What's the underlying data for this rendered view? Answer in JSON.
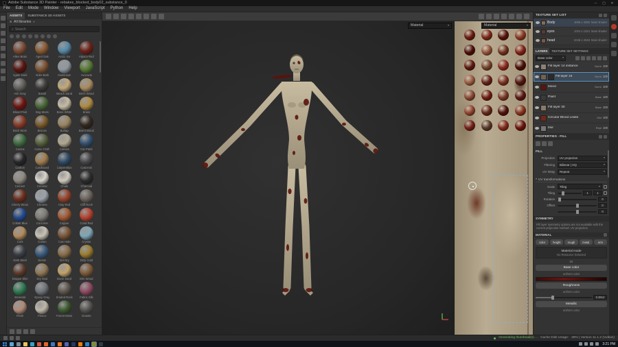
{
  "window": {
    "title": "Adobe Substance 3D Painter - rebakes_blocked_body02_substance_0",
    "menus": [
      "File",
      "Edit",
      "Mode",
      "Window",
      "Viewport",
      "JavaScript",
      "Python",
      "Help"
    ]
  },
  "tools": {
    "left_strip": [
      "paint-tool-icon",
      "eraser-tool-icon",
      "projection-tool-icon",
      "polygon-fill-tool-icon",
      "smudge-tool-icon",
      "clone-tool-icon",
      "material-picker-tool-icon",
      "quick-mask-tool-icon",
      "selection-tool-icon"
    ],
    "toolbar": [
      "transform-icon",
      "paint-brush-icon",
      "eraser-icon",
      "projection-icon",
      "fill-bucket-icon",
      "smudge-icon",
      "clone-stamp-icon",
      "geometry-mask-icon"
    ],
    "viewport_controls": [
      "pause-icon",
      "camera-icon",
      "snapshot-icon",
      "rotate-view-icon",
      "light-rotation-icon",
      "shadow-toggle-icon",
      "fullscreen-icon"
    ]
  },
  "assets": {
    "tabs": [
      "ASSETS",
      "SUBSTANCE 3D ASSETS"
    ],
    "filter_label": "All libraries",
    "search_placeholder": "Search",
    "filter_icons": [
      "filter-all-icon",
      "filter-materials-icon",
      "filter-smart-materials-icon",
      "filter-smart-masks-icon",
      "filter-brushes-icon",
      "filter-alphas-icon",
      "filter-textures-icon",
      "filter-filters-icon"
    ],
    "bottom_icons": [
      "grid-view-icon",
      "list-view-icon",
      "import-resources-icon",
      "shelf-settings-icon"
    ],
    "materials": [
      {
        "n": "Alien Brain",
        "c": "#7a4a34"
      },
      {
        "n": "Aged Oak",
        "c": "#8a5a33"
      },
      {
        "n": "Arctic Ice",
        "c": "#5588a6"
      },
      {
        "n": "Alpaca Red",
        "c": "#6e2018"
      },
      {
        "n": "Agate Dark",
        "c": "#5a1510"
      },
      {
        "n": "Alder Bark",
        "c": "#7c5232"
      },
      {
        "n": "Aluminium",
        "c": "#8e979e"
      },
      {
        "n": "Avocado",
        "c": "#567a32"
      },
      {
        "n": "Ash Gray",
        "c": "#62605c"
      },
      {
        "n": "Basalt",
        "c": "#3e3c3a"
      },
      {
        "n": "Beach Sand",
        "c": "#c2a878"
      },
      {
        "n": "Birch Wood",
        "c": "#a88a5e"
      },
      {
        "n": "Blood Pool",
        "c": "#701510"
      },
      {
        "n": "Bog Moss",
        "c": "#4a6638"
      },
      {
        "n": "Bone White",
        "c": "#c5bba2"
      },
      {
        "n": "Brass",
        "c": "#b08a42"
      },
      {
        "n": "Brick Worn",
        "c": "#8a3a28"
      },
      {
        "n": "Bronze",
        "c": "#7a5a2c"
      },
      {
        "n": "Burlap",
        "c": "#9a8460"
      },
      {
        "n": "Burnt Wood",
        "c": "#32281f"
      },
      {
        "n": "Cactus",
        "c": "#3f6b3f"
      },
      {
        "n": "Camo Cloth",
        "c": "#56603c"
      },
      {
        "n": "Canvas",
        "c": "#b0a88e"
      },
      {
        "n": "Car Paint",
        "c": "#32506e"
      },
      {
        "n": "Carbon",
        "c": "#26262a"
      },
      {
        "n": "Cardboard",
        "c": "#a07c4e"
      },
      {
        "n": "Carpet Blue",
        "c": "#2e4a66"
      },
      {
        "n": "Cast Iron",
        "c": "#46464a"
      },
      {
        "n": "Cement",
        "c": "#8e8a82"
      },
      {
        "n": "Ceramic",
        "c": "#d8d4cc"
      },
      {
        "n": "Chalk",
        "c": "#cfc9bd"
      },
      {
        "n": "Charcoal",
        "c": "#2c2c2c"
      },
      {
        "n": "Cherry Wood",
        "c": "#6e2f1e"
      },
      {
        "n": "Chrome",
        "c": "#9aa2aa"
      },
      {
        "n": "Clay Red",
        "c": "#96422a"
      },
      {
        "n": "Cliff Rock",
        "c": "#6a625a"
      },
      {
        "n": "Cobalt Blue",
        "c": "#244a8e"
      },
      {
        "n": "Concrete",
        "c": "#7e7c76"
      },
      {
        "n": "Copper",
        "c": "#a45a32"
      },
      {
        "n": "Coral Red",
        "c": "#b6422e"
      },
      {
        "n": "Cork",
        "c": "#b28a5c"
      },
      {
        "n": "Cotton",
        "c": "#c8c2b4"
      },
      {
        "n": "Cow Hide",
        "c": "#7a5636"
      },
      {
        "n": "Crystal",
        "c": "#7ea6b6"
      },
      {
        "n": "Dark Steel",
        "c": "#3a3e44"
      },
      {
        "n": "Denim",
        "c": "#3a5a7c"
      },
      {
        "n": "Dirt Dry",
        "c": "#8a6c48"
      },
      {
        "n": "Dirty Gold",
        "c": "#9a7c2e"
      },
      {
        "n": "Dragon Skin",
        "c": "#5c3a2a"
      },
      {
        "n": "Dry Mud",
        "c": "#907856"
      },
      {
        "n": "Dune Sand",
        "c": "#c2a269"
      },
      {
        "n": "Elm Wood",
        "c": "#7e5a38"
      },
      {
        "n": "Emerald",
        "c": "#2e7a52"
      },
      {
        "n": "Epoxy Gray",
        "c": "#70747a"
      },
      {
        "n": "Eroded Rock",
        "c": "#5e564c"
      },
      {
        "n": "Fabric Silk",
        "c": "#8e4a62"
      },
      {
        "n": "Flesh",
        "c": "#b08a76"
      },
      {
        "n": "Fleece",
        "c": "#bdb6a8"
      },
      {
        "n": "Forest Moss",
        "c": "#3c5a30"
      },
      {
        "n": "Granite",
        "c": "#55534f"
      }
    ]
  },
  "viewport": {
    "shading_mode": "Material"
  },
  "view2d": {
    "mode": "Material",
    "spheres": [
      "#6a1d12",
      "#7c2a1a",
      "#55150e",
      "#8a3b24",
      "#4a0f0a",
      "#93553c",
      "#6e3420",
      "#812218",
      "#5c1a10",
      "#74452e",
      "#8a2c1e",
      "#471008",
      "#9a5c42",
      "#63241a",
      "#7b3322",
      "#52160f",
      "#884a34",
      "#6d1f14",
      "#793a28",
      "#581812",
      "#90462f",
      "#65291c",
      "#4e130c",
      "#86351f",
      "#72221a",
      "#5a3a2a",
      "#832d1c",
      "#69150e"
    ]
  },
  "texture_sets": {
    "title": "TEXTURE SET LIST",
    "items": [
      {
        "name": "Body",
        "resolution": "4096 x 4096",
        "shader": "Main shader",
        "color": "#8a6a52",
        "selected": true
      },
      {
        "name": "eyes",
        "resolution": "1024 x 1024",
        "shader": "Main shader",
        "color": "#5a3c30",
        "selected": false
      },
      {
        "name": "head",
        "resolution": "2048 x 2048",
        "shader": "Main shader",
        "color": "#7a5844",
        "selected": false
      }
    ]
  },
  "layers": {
    "tabs": [
      "LAYERS",
      "TEXTURE SET SETTINGS"
    ],
    "channel_filter": "Base color",
    "toolbar_icons": [
      "filter-layers-icon",
      "add-effect-icon",
      "add-paint-layer-icon",
      "add-fill-layer-icon",
      "add-folder-icon",
      "delete-layer-icon"
    ],
    "items": [
      {
        "name": "Fill layer 14 instance",
        "blend": "Norm",
        "opacity": "100",
        "thumb": "#8a8178",
        "selected": false
      },
      {
        "name": "Fill layer 24",
        "blend": "Norm",
        "opacity": "100",
        "thumb": "#6f6354",
        "thumb2": "#2b2b2b",
        "selected": true
      },
      {
        "name": "blood",
        "blend": "Norm",
        "opacity": "100",
        "thumb": "#5a140e",
        "selected": false
      },
      {
        "name": "Paint",
        "blend": "Base",
        "opacity": "100",
        "thumb": "#3a3a3a",
        "selected": false
      },
      {
        "name": "Fill layer 30",
        "blend": "Base",
        "opacity": "100",
        "thumb": "#8a7a68",
        "selected": false
      },
      {
        "name": "Circular Blood Leaks",
        "blend": "Mul",
        "opacity": "100",
        "thumb": "#71281a",
        "selected": false
      },
      {
        "name": "blur",
        "blend": "Repl",
        "opacity": "100",
        "thumb": "#777777",
        "selected": false
      }
    ]
  },
  "properties": {
    "title": "PROPERTIES - FILL",
    "tab_icons": [
      "geometry-tab-icon",
      "material-tab-icon",
      "sliders-tab-icon"
    ],
    "section_fill": "FILL",
    "projection_label": "Projection",
    "projection_value": "UV projection",
    "filtering_label": "Filtering",
    "filtering_value": "Bilinear | HQ",
    "uv_wrap_label": "UV Wrap",
    "uv_wrap_value": "Repeat",
    "uv_transform_label": "UV transformations",
    "scale_label": "Scale",
    "scale_value": "Tiling",
    "tiling_label": "Tiling",
    "tiling_value": "1",
    "tiling_value2": "1",
    "rotation_label": "Rotation",
    "rotation_value": "0",
    "offset_label": "Offset",
    "offset_x": "0",
    "offset_y": "0",
    "symmetry_title": "SYMMETRY",
    "symmetry_note": "Fill layer symmetry options are not available with the current projection method: UV projection",
    "material_title": "MATERIAL",
    "channels": [
      "color",
      "height",
      "rough",
      "metal",
      "nrm"
    ],
    "material_mode": "Material mode",
    "no_resource": "No Resource Selected",
    "or_label": "Or",
    "base_color_label": "Base color",
    "base_color_sub": "uniform color",
    "roughness_label": "Roughness",
    "roughness_sub": "uniform color",
    "roughness_value": "0.2812",
    "roughness_pct": 28,
    "metallic_label": "Metallic",
    "metallic_sub": "uniform color"
  },
  "right_strip": {
    "icons": [
      {
        "name": "panels-icon"
      },
      {
        "name": "material-ball-icon",
        "color": "#b5392a",
        "round": true
      },
      {
        "name": "gear-icon"
      },
      {
        "name": "display-settings-icon"
      },
      {
        "name": "help-icon"
      }
    ]
  },
  "status_bar": {
    "icons": [
      "project-folder-icon",
      "log-icon",
      "resources-icon"
    ],
    "message": "Generating thumbnail(s) ...",
    "cache_label": "Cache Disk Usage:",
    "version": "38% | Version 11.1.2 (Vulkan)"
  },
  "taskbar": {
    "apps": [
      {
        "name": "search",
        "color": "#58a6d6"
      },
      {
        "name": "task-view",
        "color": "#7a8a9a"
      },
      {
        "name": "file-explorer",
        "color": "#e8c35a"
      },
      {
        "name": "edge",
        "color": "#35a3c2"
      },
      {
        "name": "chrome",
        "color": "#d6543f"
      },
      {
        "name": "firefox",
        "color": "#e0662f"
      },
      {
        "name": "photos",
        "color": "#3c78c0"
      },
      {
        "name": "vlc",
        "color": "#e87722"
      },
      {
        "name": "discord",
        "color": "#5663b0"
      },
      {
        "name": "steam",
        "color": "#223a5e"
      },
      {
        "name": "blender",
        "color": "#e87d0d"
      },
      {
        "name": "photoshop",
        "color": "#2f7fc0"
      },
      {
        "name": "substance-painter",
        "color": "#7e8a36",
        "active": true
      },
      {
        "name": "obs",
        "color": "#2f3a44"
      }
    ],
    "tray": [
      "chevron-up-icon",
      "network-icon",
      "volume-icon",
      "notifications-icon"
    ],
    "time": "3:21 PM"
  }
}
